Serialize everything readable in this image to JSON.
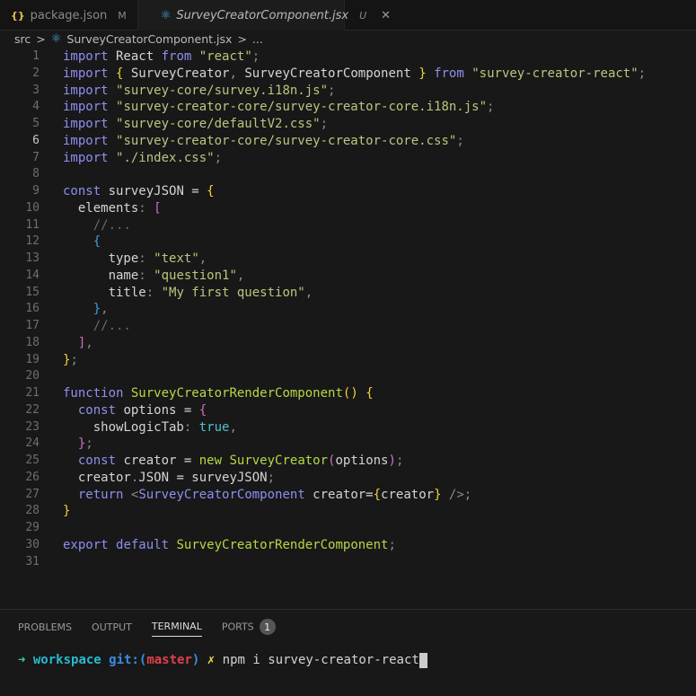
{
  "tabs": [
    {
      "label": "package.json",
      "icon": "json-braces-icon",
      "icon_text": "{}",
      "status": "M"
    },
    {
      "label": "SurveyCreatorComponent.jsx",
      "icon": "react-icon",
      "status": "U",
      "active": true
    }
  ],
  "breadcrumb": {
    "folder": "src",
    "sep": ">",
    "file": "SurveyCreatorComponent.jsx",
    "more": "..."
  },
  "colors": {
    "kw": "#8f8ff0",
    "str": "#b9c77e",
    "id": "#d4d4d4",
    "fn": "#b6d846",
    "y": "#f0d23c",
    "p": "#d070c0",
    "b": "#3a9ee0",
    "cm": "#6a6a6a",
    "pu": "#8a8a8a",
    "bool": "#4fc1d0",
    "tag": "#8f8ff0"
  },
  "current_line": 6,
  "lines": [
    [
      [
        "kw",
        "import"
      ],
      [
        "id",
        " React "
      ],
      [
        "kw",
        "from"
      ],
      [
        "id",
        " "
      ],
      [
        "str",
        "\"react\""
      ],
      [
        "pu",
        ";"
      ]
    ],
    [
      [
        "kw",
        "import"
      ],
      [
        "id",
        " "
      ],
      [
        "y",
        "{"
      ],
      [
        "id",
        " SurveyCreator"
      ],
      [
        "pu",
        ","
      ],
      [
        "id",
        " SurveyCreatorComponent "
      ],
      [
        "y",
        "}"
      ],
      [
        "id",
        " "
      ],
      [
        "kw",
        "from"
      ],
      [
        "id",
        " "
      ],
      [
        "str",
        "\"survey-creator-react\""
      ],
      [
        "pu",
        ";"
      ]
    ],
    [
      [
        "kw",
        "import"
      ],
      [
        "id",
        " "
      ],
      [
        "str",
        "\"survey-core/survey.i18n.js\""
      ],
      [
        "pu",
        ";"
      ]
    ],
    [
      [
        "kw",
        "import"
      ],
      [
        "id",
        " "
      ],
      [
        "str",
        "\"survey-creator-core/survey-creator-core.i18n.js\""
      ],
      [
        "pu",
        ";"
      ]
    ],
    [
      [
        "kw",
        "import"
      ],
      [
        "id",
        " "
      ],
      [
        "str",
        "\"survey-core/defaultV2.css\""
      ],
      [
        "pu",
        ";"
      ]
    ],
    [
      [
        "kw",
        "import"
      ],
      [
        "id",
        " "
      ],
      [
        "str",
        "\"survey-creator-core/survey-creator-core.css\""
      ],
      [
        "pu",
        ";"
      ]
    ],
    [
      [
        "kw",
        "import"
      ],
      [
        "id",
        " "
      ],
      [
        "str",
        "\"./index.css\""
      ],
      [
        "pu",
        ";"
      ]
    ],
    [],
    [
      [
        "kw",
        "const"
      ],
      [
        "id",
        " surveyJSON = "
      ],
      [
        "y",
        "{"
      ]
    ],
    [
      [
        "id",
        "  elements"
      ],
      [
        "pu",
        ":"
      ],
      [
        "id",
        " "
      ],
      [
        "p",
        "["
      ]
    ],
    [
      [
        "cm",
        "    //..."
      ]
    ],
    [
      [
        "b",
        "    {"
      ]
    ],
    [
      [
        "id",
        "      type"
      ],
      [
        "pu",
        ":"
      ],
      [
        "id",
        " "
      ],
      [
        "str",
        "\"text\""
      ],
      [
        "pu",
        ","
      ]
    ],
    [
      [
        "id",
        "      name"
      ],
      [
        "pu",
        ":"
      ],
      [
        "id",
        " "
      ],
      [
        "str",
        "\"question1\""
      ],
      [
        "pu",
        ","
      ]
    ],
    [
      [
        "id",
        "      title"
      ],
      [
        "pu",
        ":"
      ],
      [
        "id",
        " "
      ],
      [
        "str",
        "\"My first question\""
      ],
      [
        "pu",
        ","
      ]
    ],
    [
      [
        "b",
        "    }"
      ],
      [
        "pu",
        ","
      ]
    ],
    [
      [
        "cm",
        "    //..."
      ]
    ],
    [
      [
        "p",
        "  ]"
      ],
      [
        "pu",
        ","
      ]
    ],
    [
      [
        "y",
        "}"
      ],
      [
        "pu",
        ";"
      ]
    ],
    [],
    [
      [
        "kw",
        "function"
      ],
      [
        "id",
        " "
      ],
      [
        "fn",
        "SurveyCreatorRenderComponent"
      ],
      [
        "y",
        "()"
      ],
      [
        "id",
        " "
      ],
      [
        "y",
        "{"
      ]
    ],
    [
      [
        "kw",
        "  const"
      ],
      [
        "id",
        " options = "
      ],
      [
        "p",
        "{"
      ]
    ],
    [
      [
        "id",
        "    showLogicTab"
      ],
      [
        "pu",
        ":"
      ],
      [
        "id",
        " "
      ],
      [
        "bool",
        "true"
      ],
      [
        "pu",
        ","
      ]
    ],
    [
      [
        "p",
        "  }"
      ],
      [
        "pu",
        ";"
      ]
    ],
    [
      [
        "kw",
        "  const"
      ],
      [
        "id",
        " creator = "
      ],
      [
        "fn",
        "new"
      ],
      [
        "id",
        " "
      ],
      [
        "fn",
        "SurveyCreator"
      ],
      [
        "p",
        "("
      ],
      [
        "id",
        "options"
      ],
      [
        "p",
        ")"
      ],
      [
        "pu",
        ";"
      ]
    ],
    [
      [
        "id",
        "  creator"
      ],
      [
        "pu",
        "."
      ],
      [
        "id",
        "JSON = surveyJSON"
      ],
      [
        "pu",
        ";"
      ]
    ],
    [
      [
        "kw",
        "  return"
      ],
      [
        "id",
        " "
      ],
      [
        "pu",
        "<"
      ],
      [
        "tag",
        "SurveyCreatorComponent"
      ],
      [
        "id",
        " creator="
      ],
      [
        "y",
        "{"
      ],
      [
        "id",
        "creator"
      ],
      [
        "y",
        "}"
      ],
      [
        "pu",
        " />;"
      ]
    ],
    [
      [
        "y",
        "}"
      ]
    ],
    [],
    [
      [
        "kw",
        "export"
      ],
      [
        "id",
        " "
      ],
      [
        "kw",
        "default"
      ],
      [
        "id",
        " "
      ],
      [
        "fn",
        "SurveyCreatorRenderComponent"
      ],
      [
        "pu",
        ";"
      ]
    ],
    []
  ],
  "panel": {
    "tabs": [
      "PROBLEMS",
      "OUTPUT",
      "TERMINAL",
      "PORTS"
    ],
    "active": "TERMINAL",
    "ports_badge": "1"
  },
  "terminal": {
    "arrow": "➜",
    "dir": "workspace",
    "git_prefix": "git:(",
    "branch": "master",
    "git_suffix": ")",
    "dirty": "✗",
    "command": "npm i survey-creator-react"
  }
}
